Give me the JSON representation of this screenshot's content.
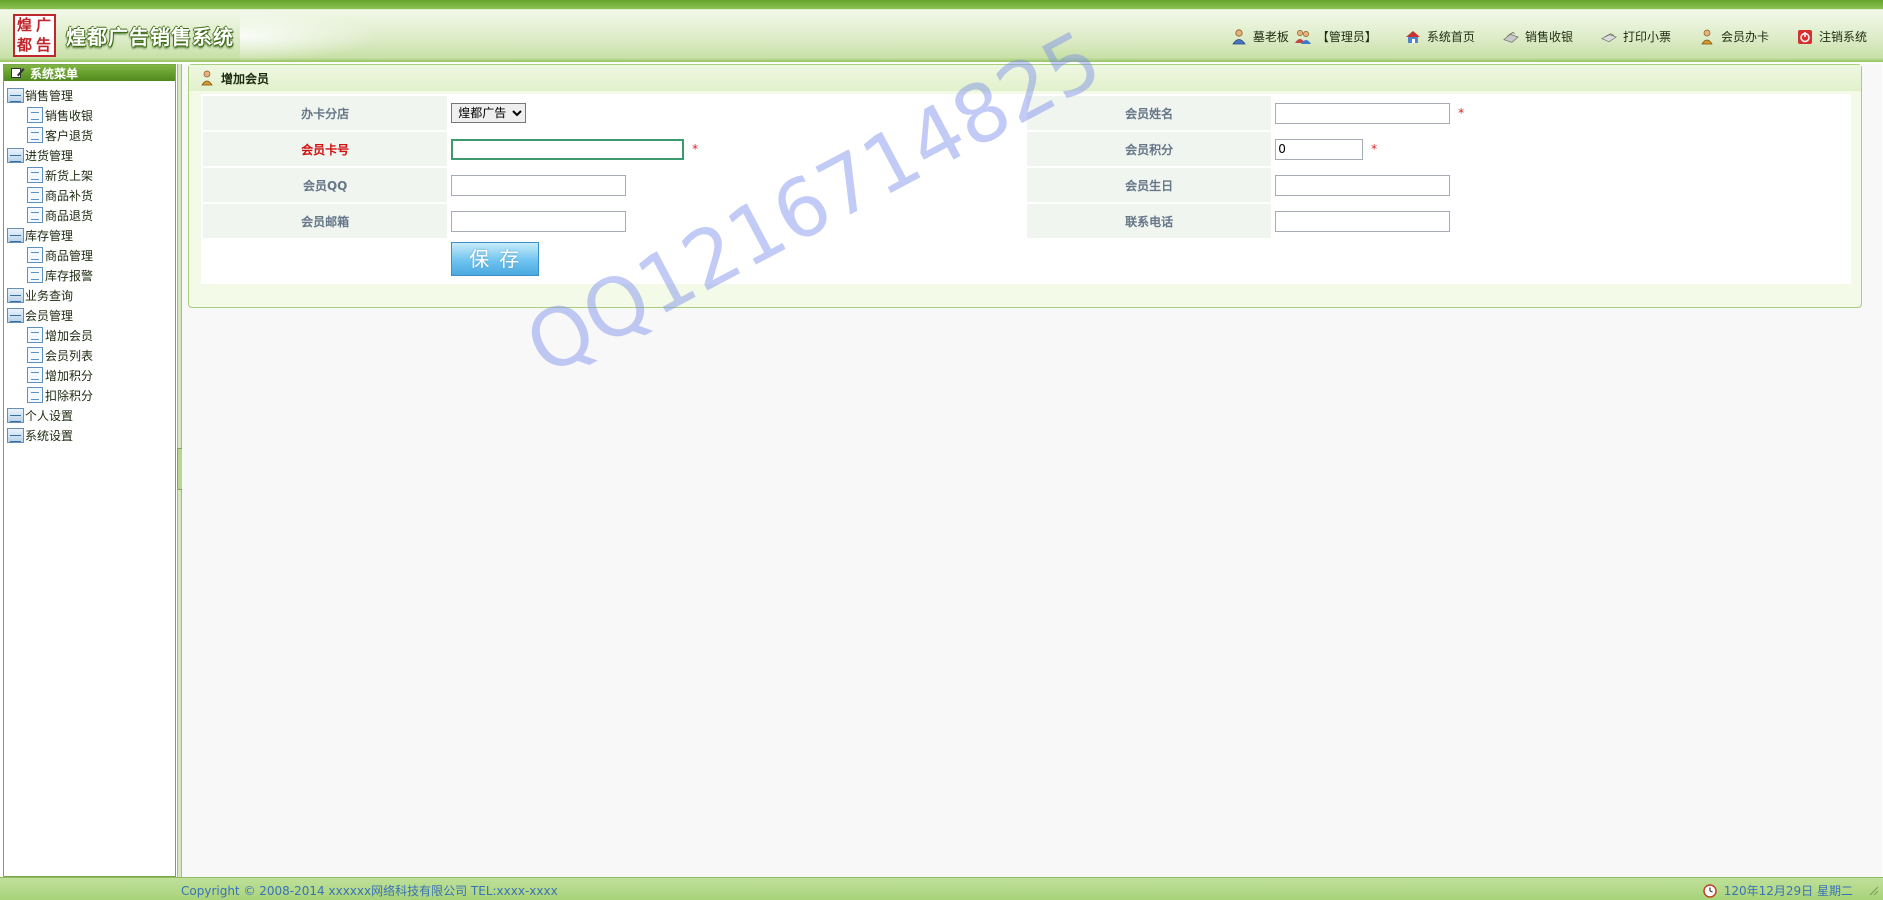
{
  "header": {
    "logo_text": [
      "煌",
      "广",
      "都",
      "告"
    ],
    "app_title": "煌都广告销售系统",
    "user_name": "墓老板",
    "user_role": "【管理员】",
    "nav": [
      {
        "label": "系统首页",
        "icon": "home-icon"
      },
      {
        "label": "销售收银",
        "icon": "cash-register-icon"
      },
      {
        "label": "打印小票",
        "icon": "printer-icon"
      },
      {
        "label": "会员办卡",
        "icon": "member-card-icon"
      },
      {
        "label": "注销系统",
        "icon": "logout-icon"
      }
    ]
  },
  "sidebar": {
    "title": "系统菜单",
    "groups": [
      {
        "label": "销售管理",
        "items": [
          "销售收银",
          "客户退货"
        ]
      },
      {
        "label": "进货管理",
        "items": [
          "新货上架",
          "商品补货",
          "商品退货"
        ]
      },
      {
        "label": "库存管理",
        "items": [
          "商品管理",
          "库存报警"
        ]
      },
      {
        "label": "业务查询",
        "items": []
      },
      {
        "label": "会员管理",
        "items": [
          "增加会员",
          "会员列表",
          "增加积分",
          "扣除积分"
        ]
      },
      {
        "label": "个人设置",
        "items": []
      },
      {
        "label": "系统设置",
        "items": []
      }
    ]
  },
  "panel": {
    "title": "增加会员"
  },
  "form": {
    "shop_label": "办卡分店",
    "shop_selected": "煌都广告",
    "name_label": "会员姓名",
    "name_value": "",
    "card_label": "会员卡号",
    "card_value": "",
    "points_label": "会员积分",
    "points_value": "0",
    "qq_label": "会员QQ",
    "qq_value": "",
    "birthday_label": "会员生日",
    "birthday_value": "",
    "email_label": "会员邮箱",
    "email_value": "",
    "phone_label": "联系电话",
    "phone_value": "",
    "required_mark": "*",
    "save_label": "保存"
  },
  "watermark": "QQ1216714825",
  "footer": {
    "copyright": "Copyright © 2008-2014 xxxxxx网络科技有限公司 TEL:xxxx-xxxx",
    "datetime": "120年12月29日 星期二"
  },
  "colors": {
    "accent_green": "#6fae33",
    "required_red": "#d01010",
    "link_blue": "#3a72b8",
    "save_blue": "#6fc3ef"
  }
}
